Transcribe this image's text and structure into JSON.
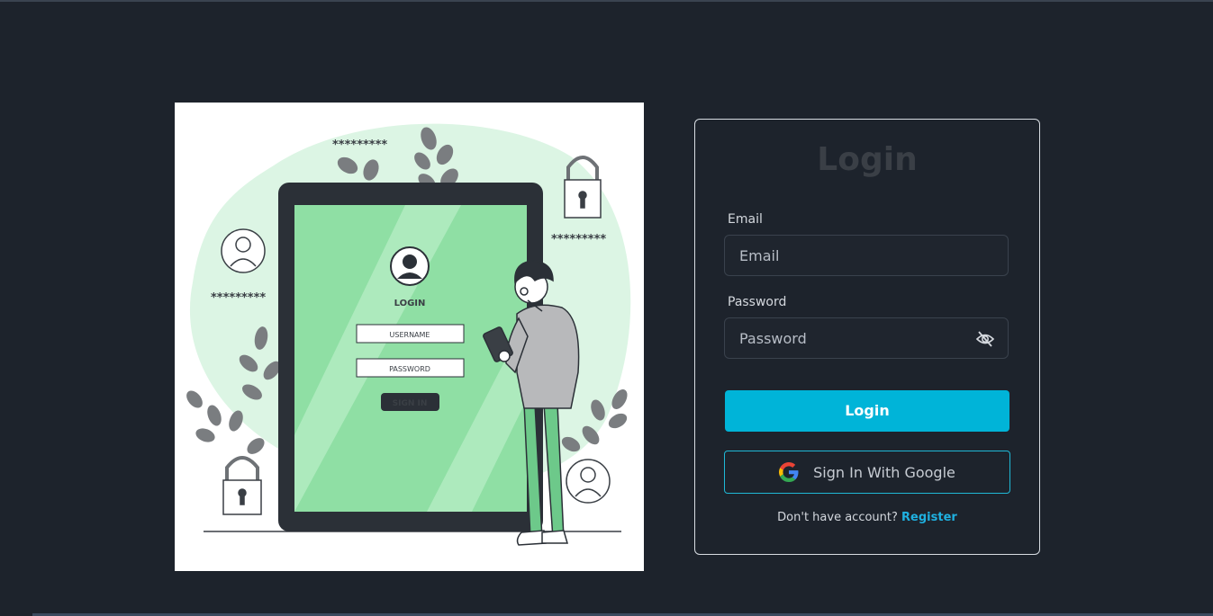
{
  "login_form": {
    "title": "Login",
    "email_label": "Email",
    "email_placeholder": "Email",
    "email_value": "",
    "password_label": "Password",
    "password_placeholder": "Password",
    "password_value": "",
    "login_button": "Login",
    "google_button": "Sign In With Google",
    "no_account_text": "Don't have account?",
    "register_link": "Register"
  },
  "illustration": {
    "heading": "LOGIN",
    "username_field": "USERNAME",
    "password_field": "PASSWORD",
    "signin_button": "SIGN IN",
    "masked_1": "*********",
    "masked_2": "*********",
    "masked_3": "*********"
  },
  "colors": {
    "background": "#1d232c",
    "accent": "#00b4d8",
    "card_border": "#d8dde3",
    "title": "#3a3f46"
  },
  "icons": {
    "password_toggle": "eye-slash-icon",
    "google": "google-g-icon"
  }
}
